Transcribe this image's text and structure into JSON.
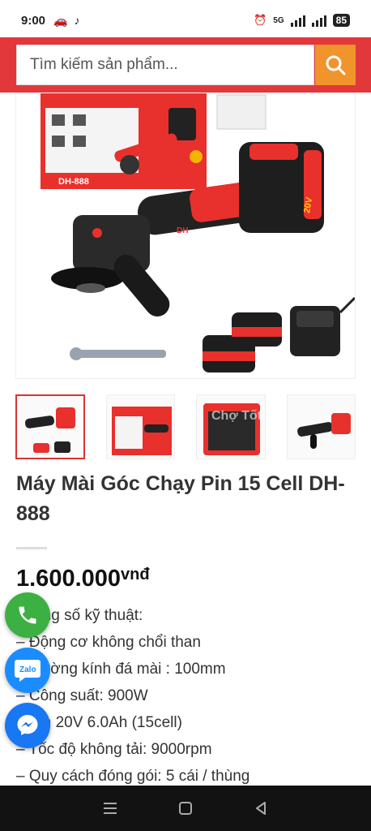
{
  "status_bar": {
    "time": "9:00",
    "network": "5G",
    "battery": "85"
  },
  "search": {
    "placeholder": "Tìm kiếm sản phẩm..."
  },
  "product": {
    "title": "Máy Mài Góc Chạy Pin 15 Cell DH-888",
    "price": "1.600.000",
    "currency": "vnđ",
    "specs": [
      "Thông số kỹ thuật:",
      "– Động cơ không chổi than",
      "– Đường kính đá mài : 100mm",
      "– Công suất: 900W",
      "– Pin 20V 6.0Ah (15cell)",
      "– Tốc độ không tải: 9000rpm",
      "– Quy cách đóng gói: 5 cái / thùng"
    ]
  },
  "image_labels": {
    "box_model": "DH-888",
    "battery_label": "20V",
    "brand": "DH",
    "watermark": "Chợ Tốt"
  },
  "colors": {
    "header": "#e2373b",
    "search_button": "#f0942c",
    "phone": "#3cb043",
    "zalo": "#1a8cff",
    "messenger": "#1877f2"
  }
}
